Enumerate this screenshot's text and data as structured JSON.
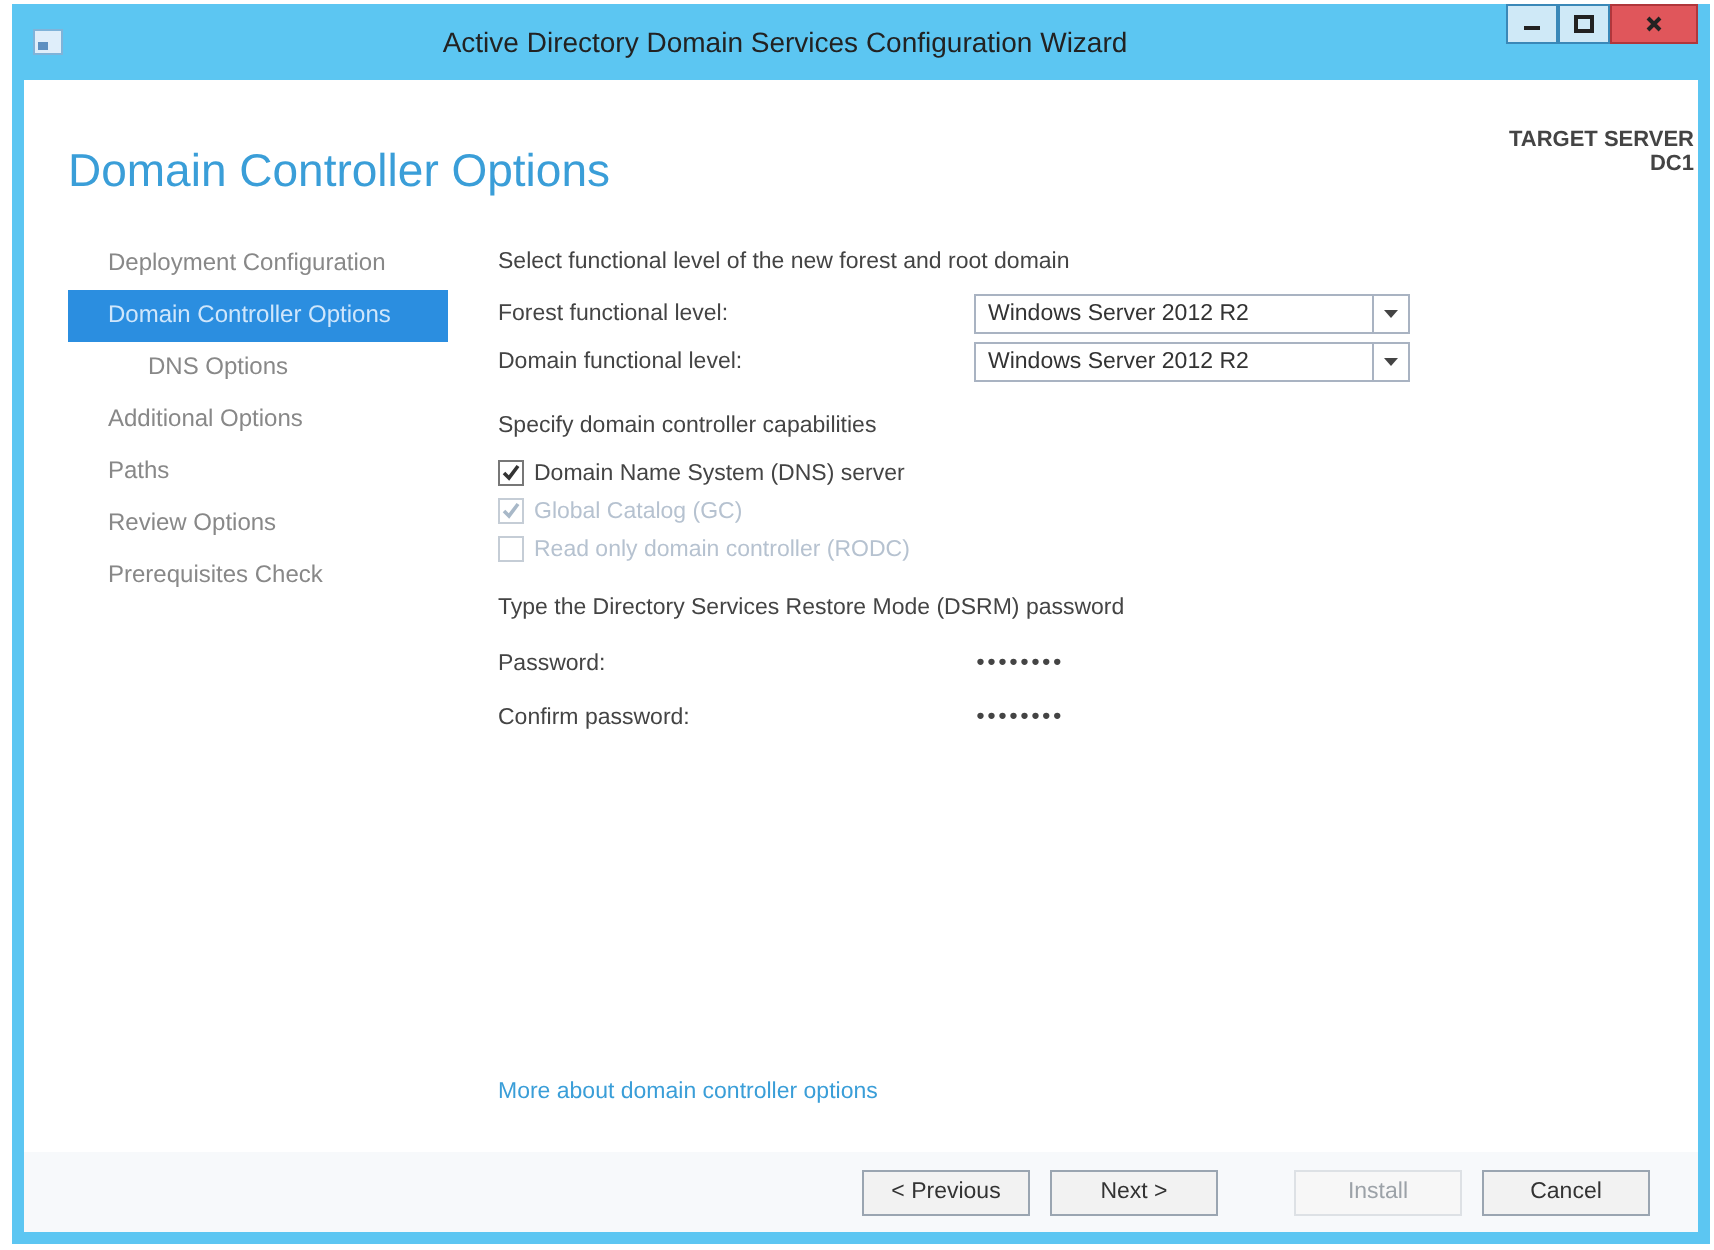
{
  "window": {
    "title": "Active Directory Domain Services Configuration Wizard"
  },
  "page_title": "Domain Controller Options",
  "target_server": {
    "label": "TARGET SERVER",
    "name": "DC1"
  },
  "sidebar": {
    "items": [
      {
        "label": "Deployment Configuration",
        "selected": false
      },
      {
        "label": "Domain Controller Options",
        "selected": true,
        "children": [
          {
            "label": "DNS Options",
            "selected": false
          }
        ]
      },
      {
        "label": "Additional Options",
        "selected": false
      },
      {
        "label": "Paths",
        "selected": false
      },
      {
        "label": "Review Options",
        "selected": false
      },
      {
        "label": "Prerequisites Check",
        "selected": false
      }
    ]
  },
  "functional_levels": {
    "heading": "Select functional level of the new forest and root domain",
    "fields": [
      {
        "label": "Forest functional level:",
        "value": "Windows Server 2012 R2"
      },
      {
        "label": "Domain functional level:",
        "value": "Windows Server 2012 R2"
      }
    ]
  },
  "capabilities": {
    "heading": "Specify domain controller capabilities",
    "options": [
      {
        "label": "Domain Name System (DNS) server",
        "checked": true,
        "disabled": false
      },
      {
        "label": "Global Catalog (GC)",
        "checked": true,
        "disabled": true
      },
      {
        "label": "Read only domain controller (RODC)",
        "checked": false,
        "disabled": true
      }
    ]
  },
  "dsrm": {
    "heading": "Type the Directory Services Restore Mode (DSRM) password",
    "fields": [
      {
        "label": "Password:",
        "value": "••••••••"
      },
      {
        "label": "Confirm password:",
        "value": "••••••••"
      }
    ]
  },
  "help_link": "More about domain controller options",
  "buttons": [
    {
      "label": "< Previous",
      "disabled": false
    },
    {
      "label": "Next >",
      "disabled": false
    },
    {
      "label": "Install",
      "disabled": true
    },
    {
      "label": "Cancel",
      "disabled": false
    }
  ]
}
